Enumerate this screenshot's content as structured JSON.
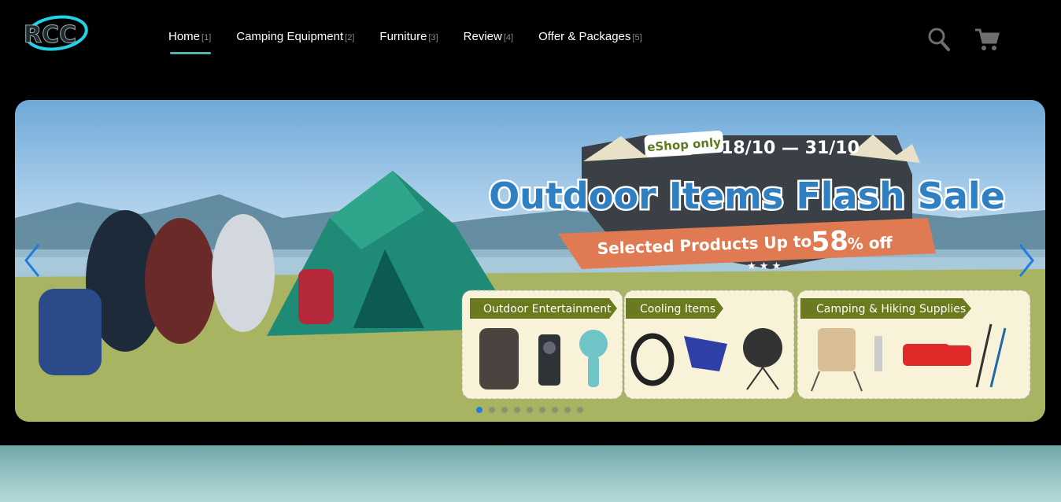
{
  "brand": {
    "logo_text": "RCC"
  },
  "nav": {
    "items": [
      {
        "label": "Home",
        "num": "[1]"
      },
      {
        "label": "Camping Equipment",
        "num": "[2]"
      },
      {
        "label": "Furniture",
        "num": "[3]"
      },
      {
        "label": "Review",
        "num": "[4]"
      },
      {
        "label": "Offer & Packages",
        "num": "[5]"
      }
    ]
  },
  "header": {
    "search_icon": "search-icon",
    "cart_icon": "cart-icon"
  },
  "banner": {
    "badge": "eShop only",
    "dates": "18/10 — 31/10",
    "title": "Outdoor Items Flash Sale",
    "subtitle_prefix": "Selected Products Up to",
    "discount": "58",
    "discount_suffix": "% off",
    "panels": [
      {
        "label": "Outdoor Entertainment"
      },
      {
        "label": "Cooling Items"
      },
      {
        "label": "Camping & Hiking Supplies"
      }
    ],
    "slide_count": 9,
    "active_slide": 1
  },
  "colors": {
    "accent": "#4fb3b0",
    "title_blue": "#2f7fc3",
    "ribbon": "#e07a52",
    "panel_tag": "#6b7a1f"
  }
}
